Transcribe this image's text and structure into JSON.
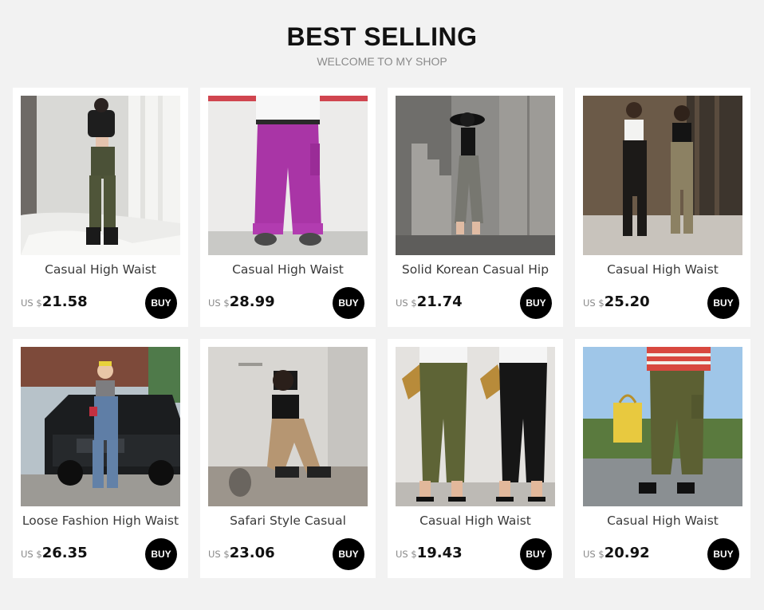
{
  "header": {
    "title": "BEST SELLING",
    "subtitle": "WELCOME TO MY SHOP"
  },
  "products": [
    {
      "name": "Casual High Waist",
      "currency": "US $",
      "price": "21.58",
      "buy_label": "BUY",
      "image": "woman-olive-cargo-pants-white-room"
    },
    {
      "name": "Casual High Waist",
      "currency": "US $",
      "price": "28.99",
      "buy_label": "BUY",
      "image": "magenta-jogger-pants-sneakers"
    },
    {
      "name": "Solid Korean Casual Hip",
      "currency": "US $",
      "price": "21.74",
      "buy_label": "BUY",
      "image": "woman-grey-pants-concrete-stairs"
    },
    {
      "name": "Casual High Waist",
      "currency": "US $",
      "price": "25.20",
      "buy_label": "BUY",
      "image": "two-women-street-black-khaki-pants"
    },
    {
      "name": "Loose Fashion High Waist",
      "currency": "US $",
      "price": "26.35",
      "buy_label": "BUY",
      "image": "woman-blue-pants-black-car"
    },
    {
      "name": "Safari Style Casual",
      "currency": "US $",
      "price": "23.06",
      "buy_label": "BUY",
      "image": "woman-khaki-pants-mirror-selfie"
    },
    {
      "name": "Casual High Waist",
      "currency": "US $",
      "price": "19.43",
      "buy_label": "BUY",
      "image": "olive-and-black-pants-heels"
    },
    {
      "name": "Casual High Waist",
      "currency": "US $",
      "price": "20.92",
      "buy_label": "BUY",
      "image": "olive-pants-yellow-bag-outdoors"
    }
  ]
}
